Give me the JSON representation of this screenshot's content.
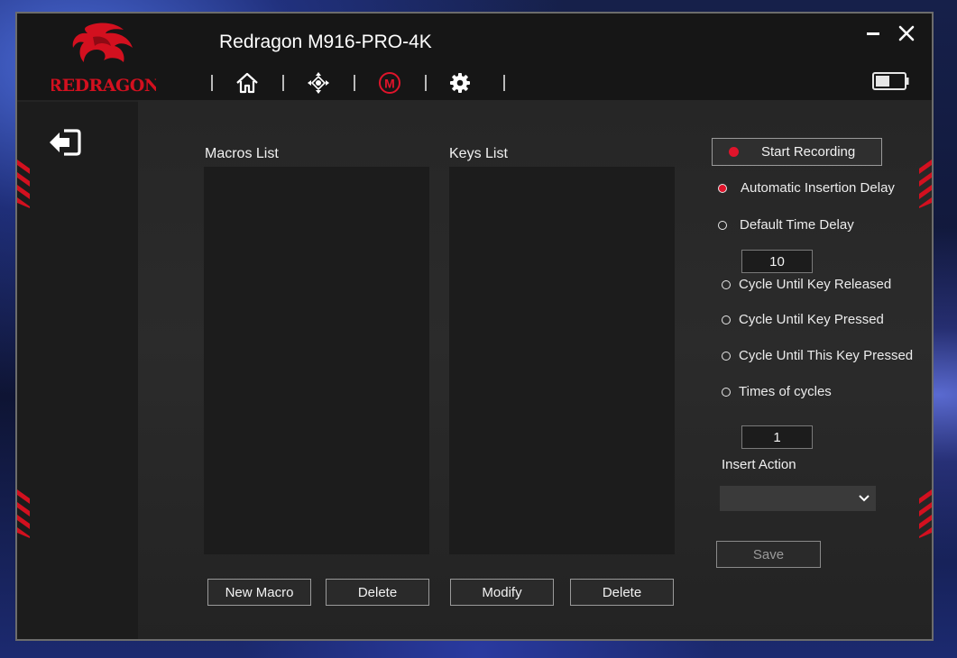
{
  "window": {
    "title": "Redragon M916-PRO-4K",
    "logo_text": "REDRAGON"
  },
  "nav": [
    "home-icon",
    "dpi-icon",
    "macro-icon",
    "settings-icon"
  ],
  "colors": {
    "accent": "#e0142b",
    "panel": "#242424",
    "header": "#161616"
  },
  "macros_list": {
    "label": "Macros List",
    "items": []
  },
  "keys_list": {
    "label": "Keys List",
    "items": []
  },
  "buttons": {
    "new_macro": "New Macro",
    "delete_macro": "Delete",
    "modify": "Modify",
    "delete_key": "Delete",
    "start_recording": "Start Recording",
    "save": "Save"
  },
  "options": {
    "automatic_insertion_delay": "Automatic Insertion Delay",
    "default_time_delay": "Default Time Delay",
    "default_time_delay_value": "10",
    "cycle_until_key_released": "Cycle Until Key Released",
    "cycle_until_key_pressed": "Cycle Until Key Pressed",
    "cycle_until_this_key_pressed": "Cycle Until This Key Pressed",
    "times_of_cycles": "Times of cycles",
    "times_of_cycles_value": "1",
    "selected_delay": "automatic_insertion_delay"
  },
  "insert_action": {
    "label": "Insert Action",
    "selected": ""
  }
}
